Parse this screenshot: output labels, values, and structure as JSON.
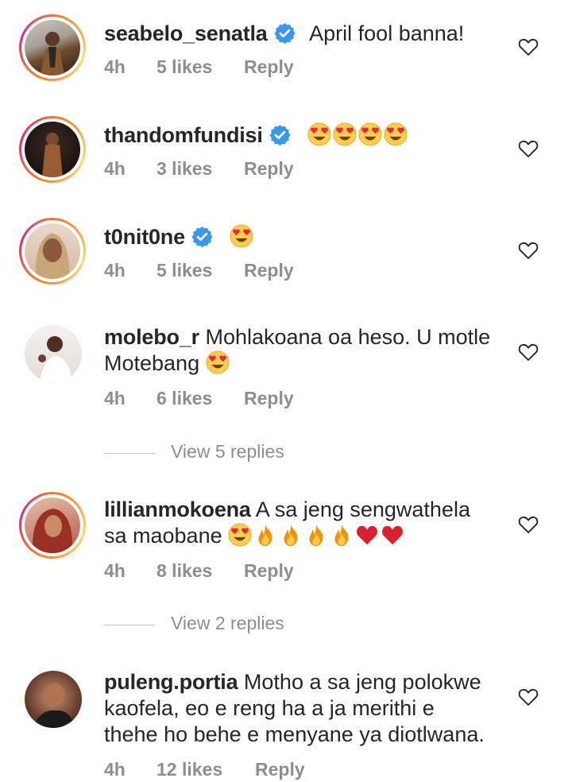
{
  "comments": [
    {
      "username": "seabelo_senatla",
      "verified": true,
      "text": "April fool banna!",
      "emojis": [],
      "time": "4h",
      "likes": "5 likes",
      "reply": "Reply",
      "avatar_ring": true
    },
    {
      "username": "thandomfundisi",
      "verified": true,
      "text": "",
      "emojis": [
        "heart-eyes",
        "heart-eyes",
        "heart-eyes",
        "heart-eyes"
      ],
      "time": "4h",
      "likes": "3 likes",
      "reply": "Reply",
      "avatar_ring": true
    },
    {
      "username": "t0nit0ne",
      "verified": true,
      "text": "",
      "emojis": [
        "heart-eyes"
      ],
      "time": "4h",
      "likes": "5 likes",
      "reply": "Reply",
      "avatar_ring": true
    },
    {
      "username": "molebo_r",
      "verified": false,
      "text_line1": "Mohlakoana oa heso. U motle",
      "text_line2": "Motebang",
      "emojis": [
        "heart-eyes"
      ],
      "time": "4h",
      "likes": "6 likes",
      "reply": "Reply",
      "avatar_ring": false,
      "view_replies": "View 5 replies"
    },
    {
      "username": "lillianmokoena",
      "verified": false,
      "text_line1": "A sa jeng sengwathela",
      "text_line2": "sa maobane",
      "emojis": [
        "heart-eyes",
        "fire",
        "fire",
        "fire",
        "fire",
        "red-heart",
        "red-heart"
      ],
      "time": "4h",
      "likes": "8 likes",
      "reply": "Reply",
      "avatar_ring": true,
      "view_replies": "View 2 replies"
    },
    {
      "username": "puleng.portia",
      "verified": false,
      "text_line1": "Motho a sa jeng polokwe",
      "text_line2": "kaofela, eo e reng ha a ja merithi e",
      "text_line3": "thehe ho behe e menyane ya diotlwana.",
      "emojis": [],
      "time": "4h",
      "likes": "12 likes",
      "reply": "Reply",
      "avatar_ring": false
    }
  ],
  "colors": {
    "text": "#262626",
    "meta": "#8e8e8e",
    "verified": "#3897f0",
    "ring_start": "#f58529",
    "ring_end": "#dd2a7b"
  }
}
